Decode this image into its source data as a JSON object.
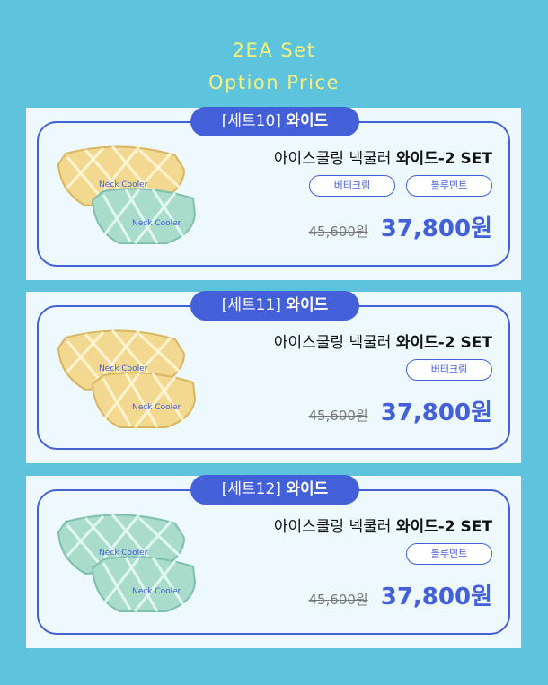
{
  "header": {
    "line1": "2EA Set",
    "line2": "Option Price"
  },
  "colors": {
    "background": "#5ec3dc",
    "accent": "#4460d8",
    "title": "#fbf07a",
    "butter": "#f3d98f",
    "mint": "#a9dccb"
  },
  "cards": [
    {
      "set_label": "[세트10]",
      "type_label": "와이드",
      "name_prefix": "아이스쿨링 넥쿨러 ",
      "name_bold": "와이드-2 SET",
      "tags": [
        "버터크림",
        "블루민트"
      ],
      "old_price": "45,600원",
      "new_price": "37,800원",
      "image_text": "Neck Cooler",
      "image_colors": [
        "butter",
        "mint"
      ]
    },
    {
      "set_label": "[세트11]",
      "type_label": "와이드",
      "name_prefix": "아이스쿨링 넥쿨러 ",
      "name_bold": "와이드-2 SET",
      "tags": [
        "버터크림"
      ],
      "old_price": "45,600원",
      "new_price": "37,800원",
      "image_text": "Neck Cooler",
      "image_colors": [
        "butter",
        "butter"
      ]
    },
    {
      "set_label": "[세트12]",
      "type_label": "와이드",
      "name_prefix": "아이스쿨링 넥쿨러 ",
      "name_bold": "와이드-2 SET",
      "tags": [
        "블루민트"
      ],
      "old_price": "45,600원",
      "new_price": "37,800원",
      "image_text": "Neck Cooler",
      "image_colors": [
        "mint",
        "mint"
      ]
    }
  ]
}
